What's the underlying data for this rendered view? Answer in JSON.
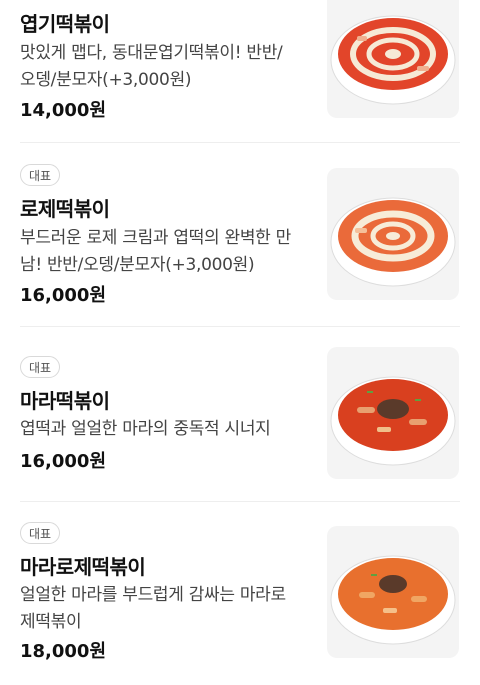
{
  "menu": {
    "items": [
      {
        "badge": "",
        "name": "엽기떡볶이",
        "desc_lines": [
          "맛있게 맵다, 동대문엽기떡볶이! 반반/",
          "오뎅/분모자(+3,000원)"
        ],
        "price": "14,000원",
        "image": "rose-tteokbokki-bowl-icon",
        "sauce": "#e2452a",
        "cream": "#f6ead6"
      },
      {
        "badge": "대표",
        "name": "로제떡볶이",
        "desc_lines": [
          "부드러운 로제 크림과 엽떡의 완벽한 만",
          "남! 반반/오뎅/분모자(+3,000원)"
        ],
        "price": "16,000원",
        "image": "rose-cream-tteokbokki-bowl-icon",
        "sauce": "#ea6a3a",
        "cream": "#f7ecd8"
      },
      {
        "badge": "대표",
        "name": "마라떡볶이",
        "desc_lines": [
          "엽떡과 얼얼한 마라의 중독적 시너지"
        ],
        "price": "16,000원",
        "image": "mala-tteokbokki-bowl-icon",
        "sauce": "#d9401f",
        "cream": "#e8a070"
      },
      {
        "badge": "대표",
        "name": "마라로제떡볶이",
        "desc_lines": [
          "얼얼한 마라를 부드럽게 감싸는 마라로",
          "제떡볶이"
        ],
        "price": "18,000원",
        "image": "mala-rose-tteokbokki-bowl-icon",
        "sauce": "#e8702e",
        "cream": "#f0a663"
      }
    ]
  },
  "colors": {
    "divider": "#eeeeee",
    "text_primary": "#111111",
    "text_secondary": "#444444",
    "thumb_bg": "#f4f4f4"
  }
}
